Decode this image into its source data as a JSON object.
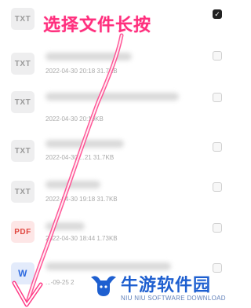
{
  "annotation_text": "选择文件长按",
  "files": [
    {
      "type_label": "TXT",
      "meta": "",
      "checked": true,
      "icon": "txt-file-icon"
    },
    {
      "type_label": "TXT",
      "meta": "2022-04-30 20:18 31.7KB",
      "checked": false,
      "icon": "txt-file-icon"
    },
    {
      "type_label": "TXT",
      "meta": "2022-04-30 20:19KB",
      "checked": false,
      "icon": "txt-file-icon"
    },
    {
      "type_label": "TXT",
      "meta": "2022-04-30 ...21 31.7KB",
      "checked": false,
      "icon": "txt-file-icon"
    },
    {
      "type_label": "TXT",
      "meta": "2022-04-30 19:18 31.7KB",
      "checked": false,
      "icon": "txt-file-icon"
    },
    {
      "type_label": "PDF",
      "meta": "2022-04-30 18:44 1.73KB",
      "checked": false,
      "icon": "pdf-file-icon"
    },
    {
      "type_label": "W",
      "meta": "...-09-25 2",
      "checked": false,
      "icon": "word-file-icon"
    }
  ],
  "watermark": {
    "title": "牛游软件园",
    "subtitle": "NIU NIU SOFTWARE DOWNLOAD",
    "accent": "#1e5fd0"
  },
  "colors": {
    "annotation": "#ff2f7d",
    "pdf": "#e0473f",
    "word": "#2f6be0"
  }
}
